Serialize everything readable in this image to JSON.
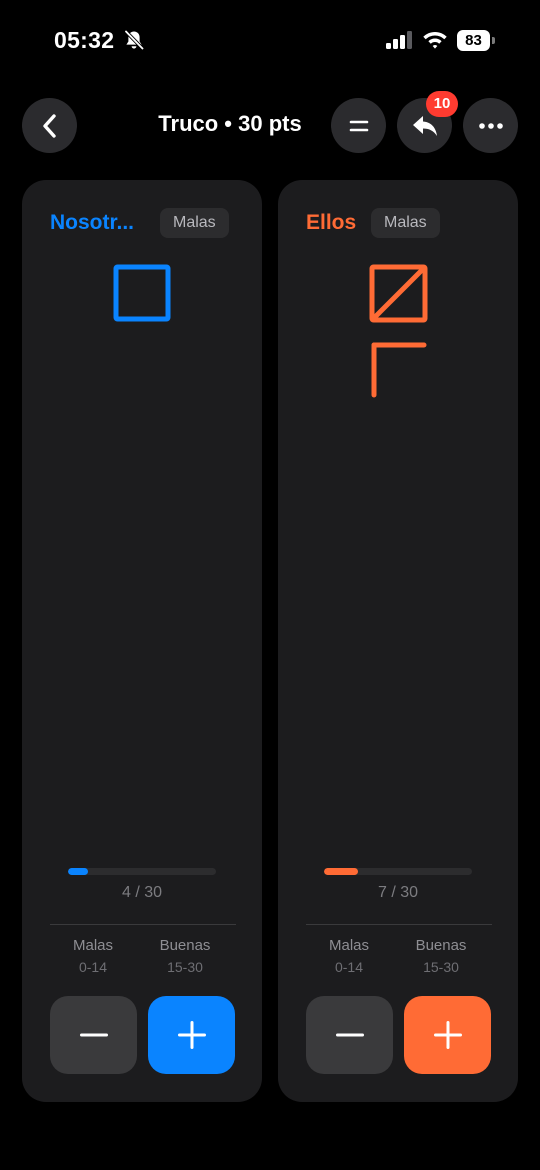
{
  "status": {
    "time": "05:32",
    "battery": "83"
  },
  "header": {
    "title": "Truco • 30 pts",
    "undo_badge": "10"
  },
  "teams": [
    {
      "name": "Nosotr...",
      "chip": "Malas",
      "color": "#0a84ff",
      "score": 4,
      "max": 30,
      "score_text": "4 / 30",
      "progress": 0.133,
      "malas_label": "Malas",
      "malas_range": "0-14",
      "buenas_label": "Buenas",
      "buenas_range": "15-30"
    },
    {
      "name": "Ellos",
      "chip": "Malas",
      "color": "#ff6b35",
      "score": 7,
      "max": 30,
      "score_text": "7 / 30",
      "progress": 0.233,
      "malas_label": "Malas",
      "malas_range": "0-14",
      "buenas_label": "Buenas",
      "buenas_range": "15-30"
    }
  ],
  "icons": {
    "back": "chevron-left-icon",
    "equal": "equal-icon",
    "undo": "undo-arrow-icon",
    "more": "ellipsis-icon",
    "minus": "minus-icon",
    "plus": "plus-icon"
  }
}
